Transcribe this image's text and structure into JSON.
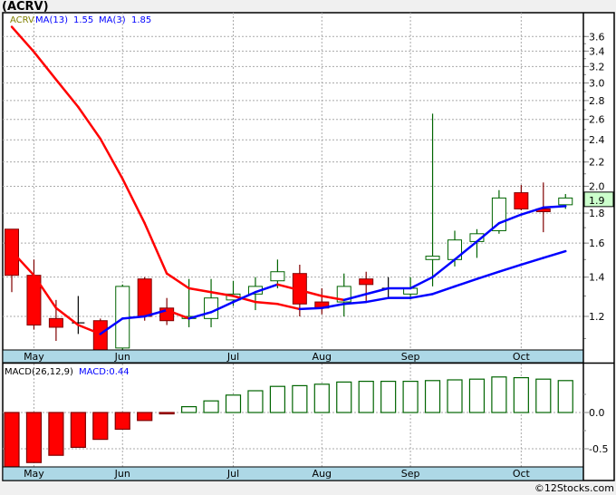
{
  "title": "(ACRV)",
  "footer": "©12Stocks.com",
  "colors": {
    "up_border": "#006400",
    "down_fill": "#ff0000",
    "down_border": "#800000",
    "ma_rising": "#0000ff",
    "ma_falling": "#ff0000",
    "axis_band": "#add8e6",
    "last_price_bg": "#ccffcc"
  },
  "legend": {
    "symbol": "ACRV",
    "ma13_label": "MA(13)",
    "ma13_value": "1.55",
    "ma3_label": "MA(3)",
    "ma3_value": "1.85",
    "macd_label": "MACD(26,12,9)",
    "macd_value": "MACD:0.44"
  },
  "chart_data": [
    {
      "type": "candlestick",
      "scale": "log",
      "ylim": [
        1.03,
        3.8
      ],
      "yticks": [
        "3.6",
        "3.4",
        "3.2",
        "3.0",
        "2.8",
        "2.6",
        "2.4",
        "2.2",
        "2.0",
        "1.8",
        "1.6",
        "1.4",
        "1.2"
      ],
      "month_labels": [
        "May",
        "Jun",
        "Jul",
        "Aug",
        "Sep",
        "Oct"
      ],
      "month_index": [
        1,
        5,
        10,
        14,
        18,
        23
      ],
      "last_price": "1.9",
      "grid": true,
      "ohlc": [
        [
          1.69,
          1.69,
          1.32,
          1.41
        ],
        [
          1.41,
          1.5,
          1.14,
          1.16
        ],
        [
          1.19,
          1.28,
          1.09,
          1.15
        ],
        [
          1.17,
          1.3,
          1.12,
          1.17
        ],
        [
          1.18,
          1.19,
          1.03,
          1.04
        ],
        [
          1.06,
          1.36,
          1.05,
          1.35
        ],
        [
          1.39,
          1.4,
          1.18,
          1.2
        ],
        [
          1.24,
          1.29,
          1.16,
          1.18
        ],
        [
          1.19,
          1.39,
          1.15,
          1.2
        ],
        [
          1.19,
          1.39,
          1.15,
          1.29
        ],
        [
          1.28,
          1.38,
          1.25,
          1.31
        ],
        [
          1.31,
          1.4,
          1.23,
          1.35
        ],
        [
          1.38,
          1.5,
          1.34,
          1.43
        ],
        [
          1.42,
          1.47,
          1.2,
          1.26
        ],
        [
          1.27,
          1.34,
          1.21,
          1.24
        ],
        [
          1.27,
          1.42,
          1.2,
          1.35
        ],
        [
          1.39,
          1.43,
          1.27,
          1.36
        ],
        [
          1.34,
          1.4,
          1.29,
          1.34
        ],
        [
          1.31,
          1.4,
          1.29,
          1.34
        ],
        [
          1.5,
          2.66,
          1.35,
          1.52
        ],
        [
          1.5,
          1.68,
          1.46,
          1.62
        ],
        [
          1.61,
          1.69,
          1.51,
          1.66
        ],
        [
          1.68,
          1.97,
          1.66,
          1.91
        ],
        [
          1.95,
          2.01,
          1.82,
          1.83
        ],
        [
          1.83,
          2.03,
          1.67,
          1.81
        ],
        [
          1.86,
          1.94,
          1.83,
          1.91
        ]
      ],
      "series": [
        {
          "name": "MA(13)",
          "values": [
            3.74,
            3.39,
            3.04,
            2.73,
            2.41,
            2.06,
            1.73,
            1.42,
            1.34,
            1.32,
            1.3,
            1.27,
            1.26,
            1.235,
            1.24,
            1.26,
            1.27,
            1.29,
            1.29,
            1.31,
            1.35,
            1.39,
            1.43,
            1.47,
            1.51,
            1.55
          ]
        },
        {
          "name": "MA(3)",
          "values": [
            1.55,
            1.41,
            1.24,
            1.16,
            1.12,
            1.19,
            1.2,
            1.23,
            1.19,
            1.22,
            1.27,
            1.32,
            1.36,
            1.33,
            1.3,
            1.28,
            1.31,
            1.34,
            1.34,
            1.4,
            1.5,
            1.61,
            1.73,
            1.79,
            1.84,
            1.85
          ]
        }
      ]
    },
    {
      "type": "bar",
      "name": "MACD(26,12,9)",
      "yticks": [
        "0.0",
        "-0.5"
      ],
      "ylim": [
        -0.75,
        0.66
      ],
      "values": [
        -0.78,
        -0.69,
        -0.59,
        -0.48,
        -0.37,
        -0.23,
        -0.11,
        -0.01,
        0.08,
        0.16,
        0.24,
        0.3,
        0.36,
        0.37,
        0.39,
        0.42,
        0.43,
        0.43,
        0.43,
        0.44,
        0.45,
        0.46,
        0.49,
        0.48,
        0.46,
        0.44
      ]
    }
  ]
}
